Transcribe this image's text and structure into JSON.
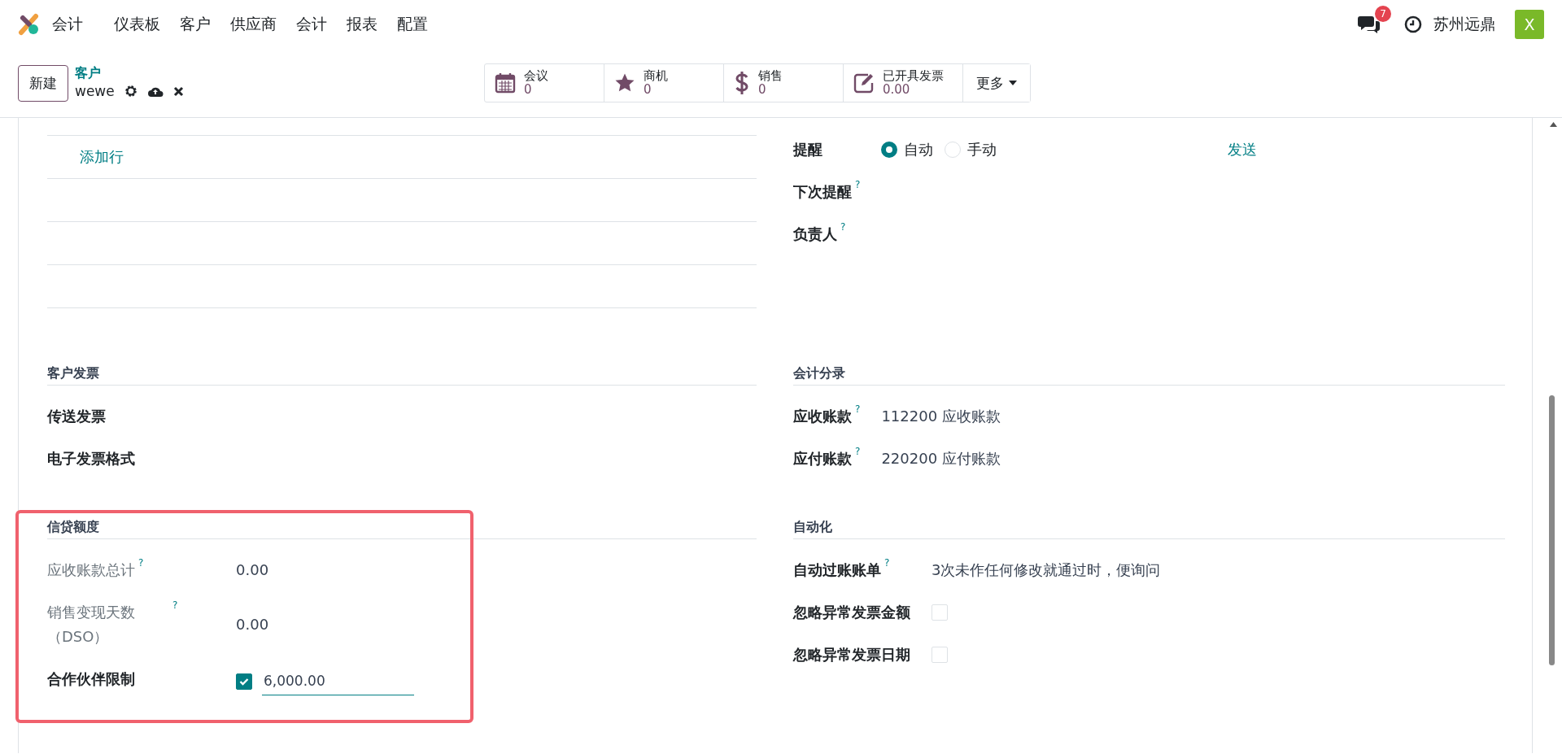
{
  "navbar": {
    "app_name": "会计",
    "menus": [
      "仪表板",
      "客户",
      "供应商",
      "会计",
      "报表",
      "配置"
    ],
    "message_count": "7",
    "company": "苏州远鼎",
    "avatar_letter": "X"
  },
  "control_panel": {
    "new_button": "新建",
    "breadcrumb": "客户",
    "record_name": "wewe",
    "stat_buttons": [
      {
        "kind": "calendar",
        "label": "会议",
        "value": "0"
      },
      {
        "kind": "star",
        "label": "商机",
        "value": "0"
      },
      {
        "kind": "dollar",
        "label": "销售",
        "value": "0"
      },
      {
        "kind": "invoice",
        "label": "已开具发票",
        "value": "0.00"
      }
    ],
    "more_button": "更多"
  },
  "bank_accounts": {
    "add_line": "添加行"
  },
  "reminder": {
    "label": "提醒",
    "options": [
      {
        "label": "自动",
        "selected": true
      },
      {
        "label": "手动",
        "selected": false
      }
    ],
    "send_link": "发送",
    "fields": [
      {
        "label": "下次提醒",
        "help": "?"
      },
      {
        "label": "负责人",
        "help": "?"
      }
    ]
  },
  "sections": [
    {
      "title": "客户发票",
      "highlighted": false,
      "fields": [
        {
          "kind": "text",
          "label": "传送发票",
          "readonly": false
        },
        {
          "kind": "text",
          "label": "电子发票格式",
          "readonly": false
        }
      ]
    },
    {
      "title": "会计分录",
      "highlighted": false,
      "fields": [
        {
          "kind": "text",
          "label": "应收账款",
          "help": "?",
          "value": "112200 应收账款",
          "readonly": false
        },
        {
          "kind": "text",
          "label": "应付账款",
          "help": "?",
          "value": "220200 应付账款",
          "readonly": false
        }
      ]
    },
    {
      "title": "信贷额度",
      "highlighted": true,
      "fields": [
        {
          "kind": "text",
          "label": "应收账款总计",
          "help": "?",
          "value": "0.00",
          "readonly": true
        },
        {
          "kind": "text",
          "label": "销售变现天数（DSO）",
          "help": "?",
          "value": "0.00",
          "readonly": true
        },
        {
          "kind": "limit",
          "label": "合作伙伴限制",
          "checked": true,
          "value": "6,000.00",
          "readonly": false
        }
      ]
    },
    {
      "title": "自动化",
      "highlighted": false,
      "fields": [
        {
          "kind": "text",
          "label": "自动过账账单",
          "help": "?",
          "value": "3次未作任何修改就通过时，便询问",
          "readonly": false
        },
        {
          "kind": "checkbox",
          "label": "忽略异常发票金额",
          "checked": false,
          "readonly": false
        },
        {
          "kind": "checkbox",
          "label": "忽略异常发票日期",
          "checked": false,
          "readonly": false
        }
      ]
    }
  ]
}
